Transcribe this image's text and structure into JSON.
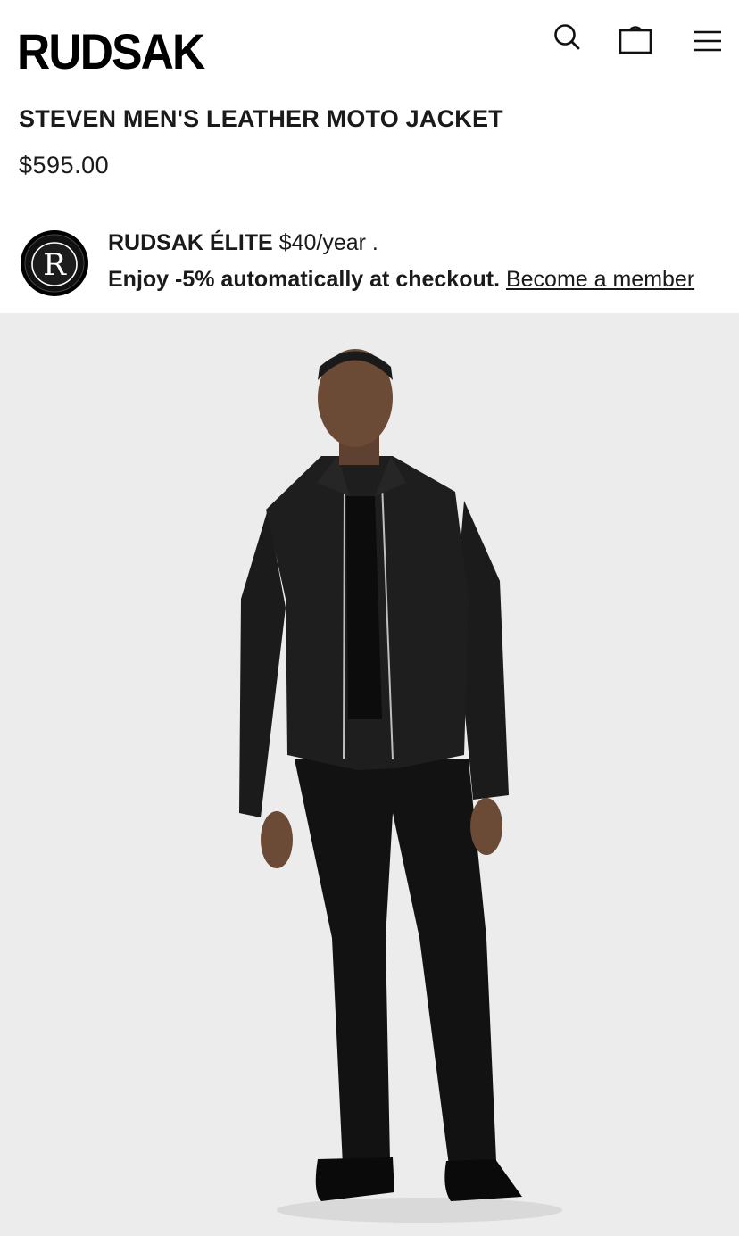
{
  "brand": {
    "logo_text": "RUDSAK"
  },
  "header": {
    "icons": [
      "search-icon",
      "shopping-bag-icon",
      "hamburger-menu-icon"
    ]
  },
  "product": {
    "title": "STEVEN MEN'S LEATHER MOTO JACKET",
    "price": "$595.00"
  },
  "elite": {
    "badge_letter": "R",
    "name": "RUDSAK ÉLITE",
    "price": "$40/year .",
    "enjoy_text": "Enjoy -5% automatically at checkout.",
    "link_text": "Become a member"
  },
  "hero": {
    "image": "model wearing black leather moto jacket, black tee, black trousers and black sneakers",
    "background_color": "#ececec"
  }
}
